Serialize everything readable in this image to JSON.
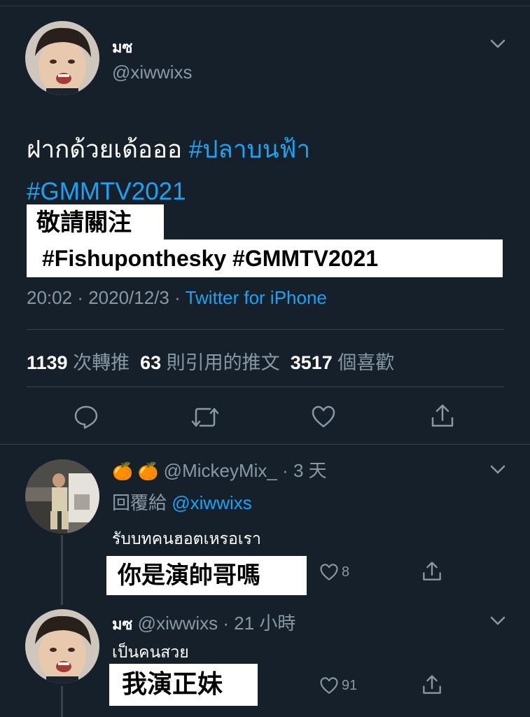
{
  "tweet": {
    "display_name": "มซ",
    "handle": "@xiwwixs",
    "text_line1": "ฝากด้วยเด้อออ",
    "hashtag1": "#ปลาบนฟ้า",
    "hashtag2": "#GMMTV2021",
    "overlay_line1": "敬請關注",
    "overlay_line2": "#Fishuponthesky #GMMTV2021",
    "time": "20:02",
    "date": "2020/12/3",
    "separator": "·",
    "source": "Twitter for iPhone",
    "stats": {
      "retweets": "1139",
      "retweets_label": "次轉推",
      "quotes": "63",
      "quotes_label": "則引用的推文",
      "likes": "3517",
      "likes_label": "個喜歡"
    },
    "actions": [
      "reply-icon",
      "retweet-icon",
      "like-icon",
      "share-icon"
    ]
  },
  "replies": [
    {
      "emoji": "🍊 🍊",
      "handle": "@MickeyMix_",
      "time": "· 3 天",
      "replying_label": "回覆給",
      "replying_to": "@xiwwixs",
      "text": "รับบทคนฮอตเหรอเรา",
      "overlay": "你是演帥哥嗎",
      "like_count": "8"
    },
    {
      "display_name": "มซ",
      "handle": "@xiwwixs",
      "time": "· 21 小時",
      "text": "เป็นคนสวย",
      "overlay": "我演正妹",
      "like_count": "91"
    }
  ],
  "colors": {
    "background": "#15202b",
    "accent": "#1da1f2",
    "secondary_text": "#8899a6",
    "divider": "#38444d"
  }
}
